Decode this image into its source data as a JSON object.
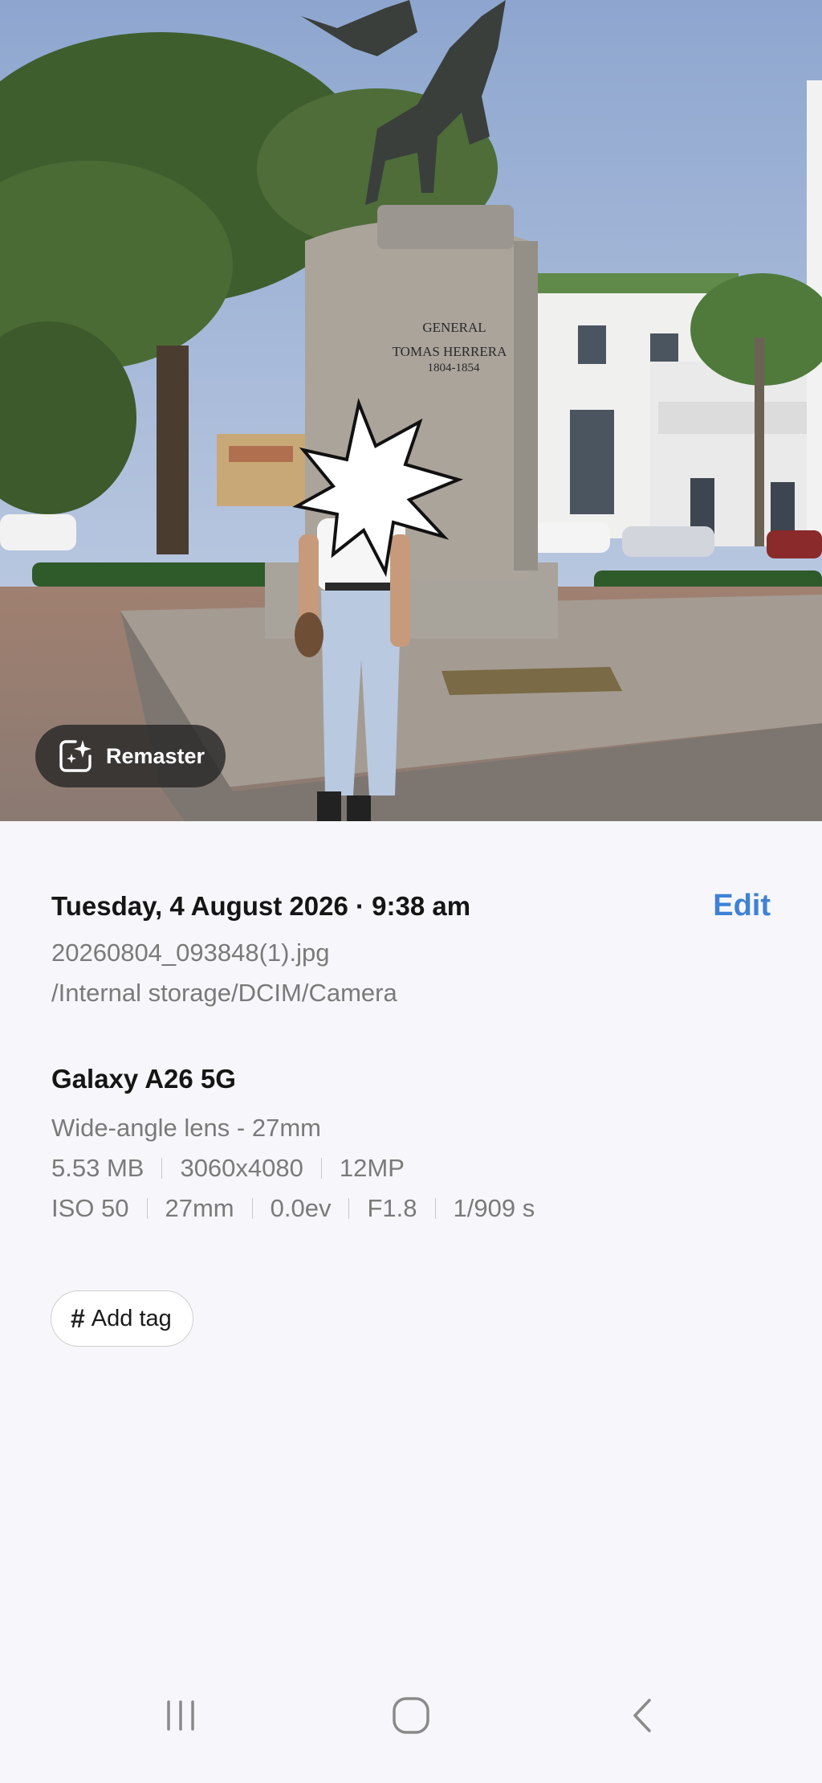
{
  "photo": {
    "monument_inscription": [
      "GENERAL",
      "TOMAS HERRERA",
      "1804-1854"
    ],
    "remaster_label": "Remaster"
  },
  "details": {
    "datetime": "Tuesday, 4 August 2026 · 9:38 am",
    "edit_label": "Edit",
    "filename": "20260804_093848(1).jpg",
    "path": "/Internal storage/DCIM/Camera",
    "device": "Galaxy A26 5G",
    "lens": "Wide-angle lens - 27mm",
    "file_specs": [
      "5.53 MB",
      "3060x4080",
      "12MP"
    ],
    "camera_specs": [
      "ISO 50",
      "27mm",
      "0.0ev",
      "F1.8",
      "1/909 s"
    ],
    "add_tag_label": "Add tag"
  },
  "navbar": {
    "icons": [
      "recent-apps-icon",
      "home-icon",
      "back-icon"
    ]
  },
  "colors": {
    "accent": "#3e82d6",
    "background": "#f7f7fb"
  }
}
